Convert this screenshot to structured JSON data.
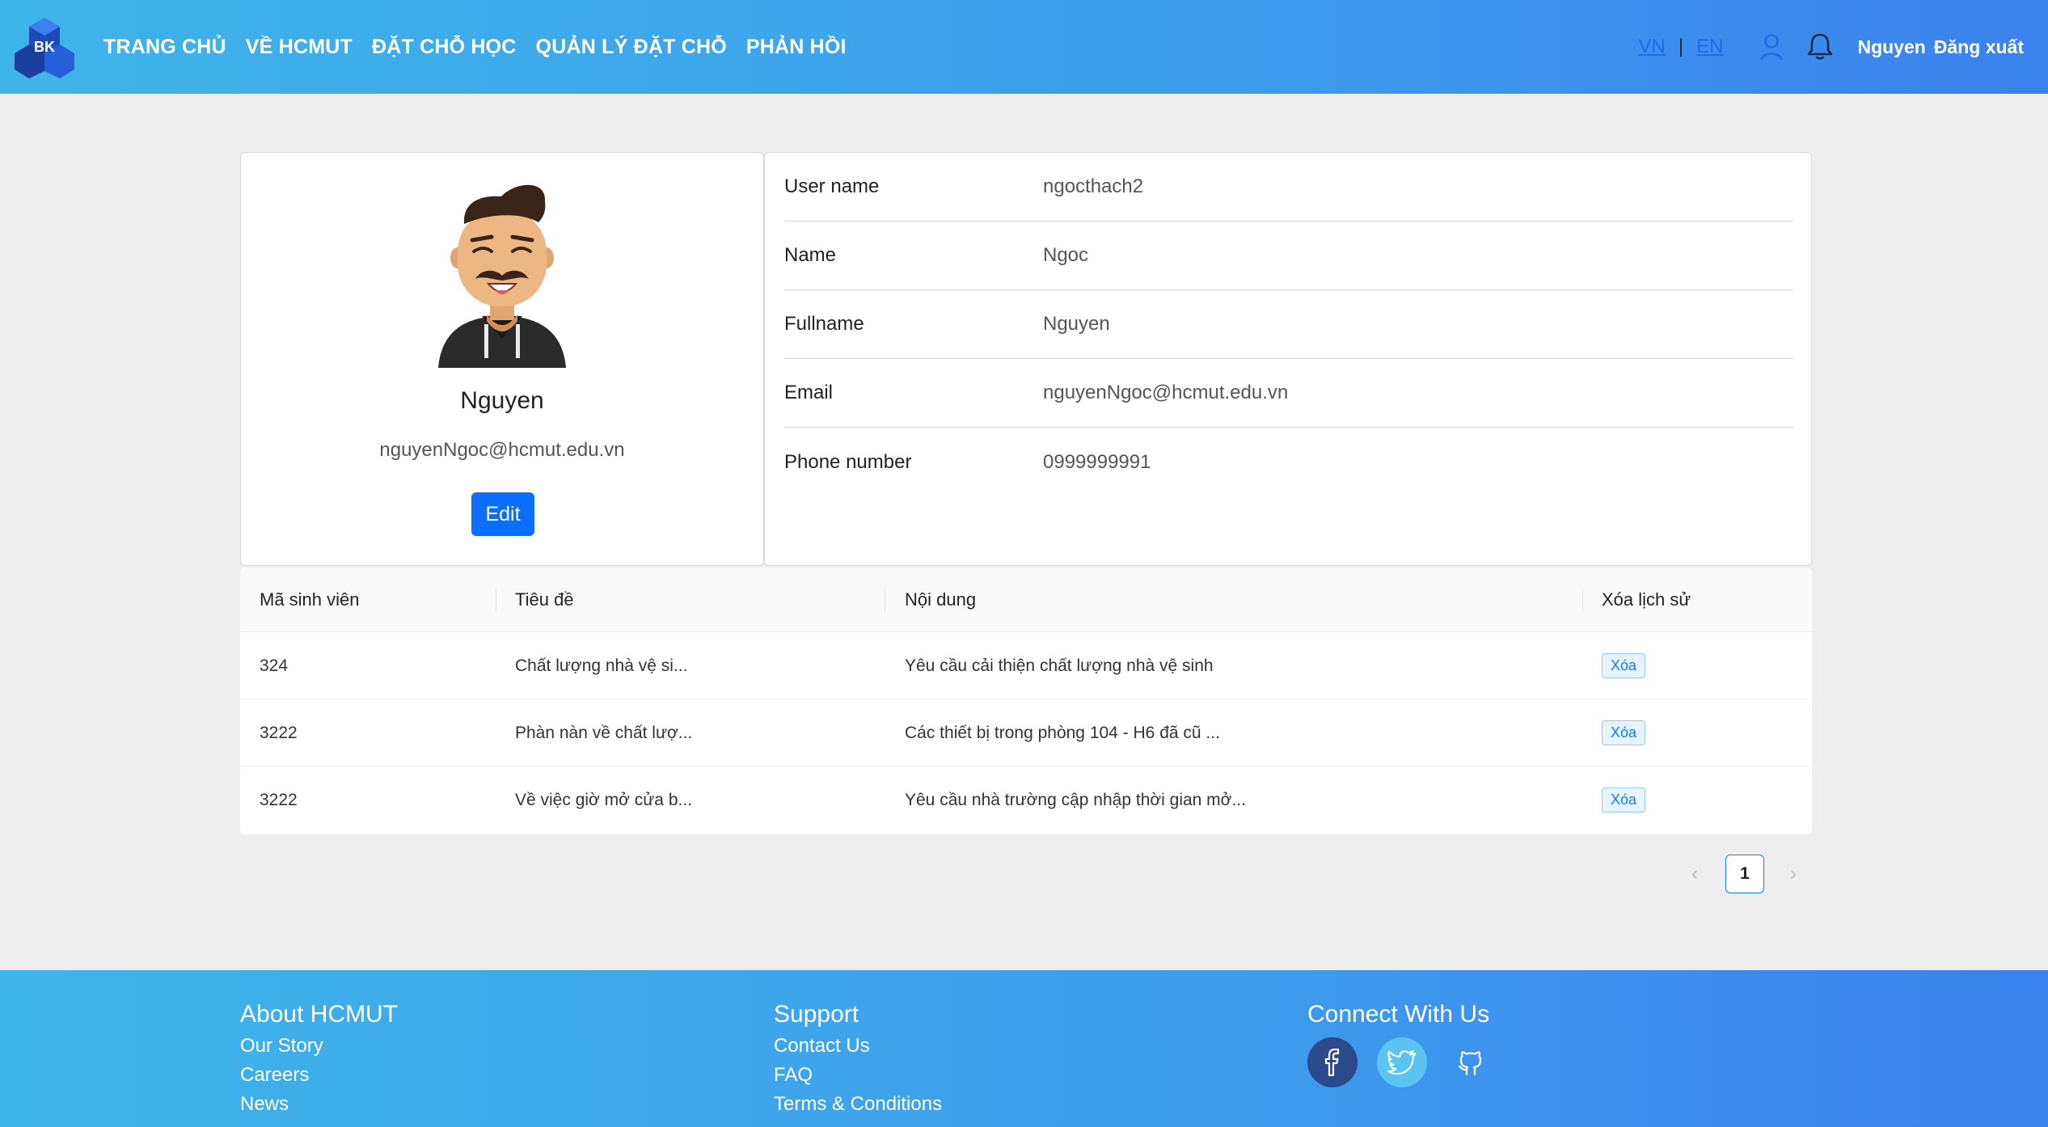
{
  "nav": {
    "logo_text": "BK",
    "links": [
      "TRANG CHỦ",
      "VỀ HCMUT",
      "ĐẶT CHỖ HỌC",
      "QUẢN LÝ ĐẶT CHỖ",
      "PHẢN HỒI"
    ],
    "lang_vn": "VN",
    "lang_sep": "|",
    "lang_en": "EN",
    "user_icon": "user-icon",
    "bell_icon": "bell-icon",
    "user_name": "Nguyen",
    "logout": "Đăng xuất"
  },
  "profile": {
    "name": "Nguyen",
    "email": "nguyenNgoc@hcmut.edu.vn",
    "edit_label": "Edit"
  },
  "info": [
    {
      "label": "User name",
      "value": "ngocthach2"
    },
    {
      "label": "Name",
      "value": "Ngoc"
    },
    {
      "label": "Fullname",
      "value": "Nguyen"
    },
    {
      "label": "Email",
      "value": "nguyenNgoc@hcmut.edu.vn"
    },
    {
      "label": "Phone number",
      "value": "0999999991"
    }
  ],
  "table": {
    "headers": [
      "Mã sinh viên",
      "Tiêu đề",
      "Nội dung",
      "Xóa lịch sử"
    ],
    "rows": [
      {
        "id": "324",
        "title": "Chất lượng nhà vệ si...",
        "content": "Yêu cầu cải thiện chất lượng nhà vệ sinh",
        "action": "Xóa"
      },
      {
        "id": "3222",
        "title": "Phàn nàn về chất lượ...",
        "content": "Các thiết bị trong phòng 104 - H6 đã cũ ...",
        "action": "Xóa"
      },
      {
        "id": "3222",
        "title": "Về việc giờ mở cửa b...",
        "content": "Yêu cầu nhà trường cập nhập thời gian mở...",
        "action": "Xóa"
      }
    ]
  },
  "pagination": {
    "prev": "‹",
    "current": "1",
    "next": "›"
  },
  "footer": {
    "about": {
      "title": "About HCMUT",
      "links": [
        "Our Story",
        "Careers",
        "News"
      ]
    },
    "support": {
      "title": "Support",
      "links": [
        "Contact Us",
        "FAQ",
        "Terms & Conditions"
      ]
    },
    "connect": {
      "title": "Connect With Us",
      "icons": [
        "facebook-icon",
        "twitter-icon",
        "github-icon"
      ]
    }
  },
  "colors": {
    "primary": "#0d6efd",
    "nav_gradient_start": "#3fb4ea",
    "nav_gradient_end": "#3b82ec",
    "tag_text": "#1677ff"
  }
}
